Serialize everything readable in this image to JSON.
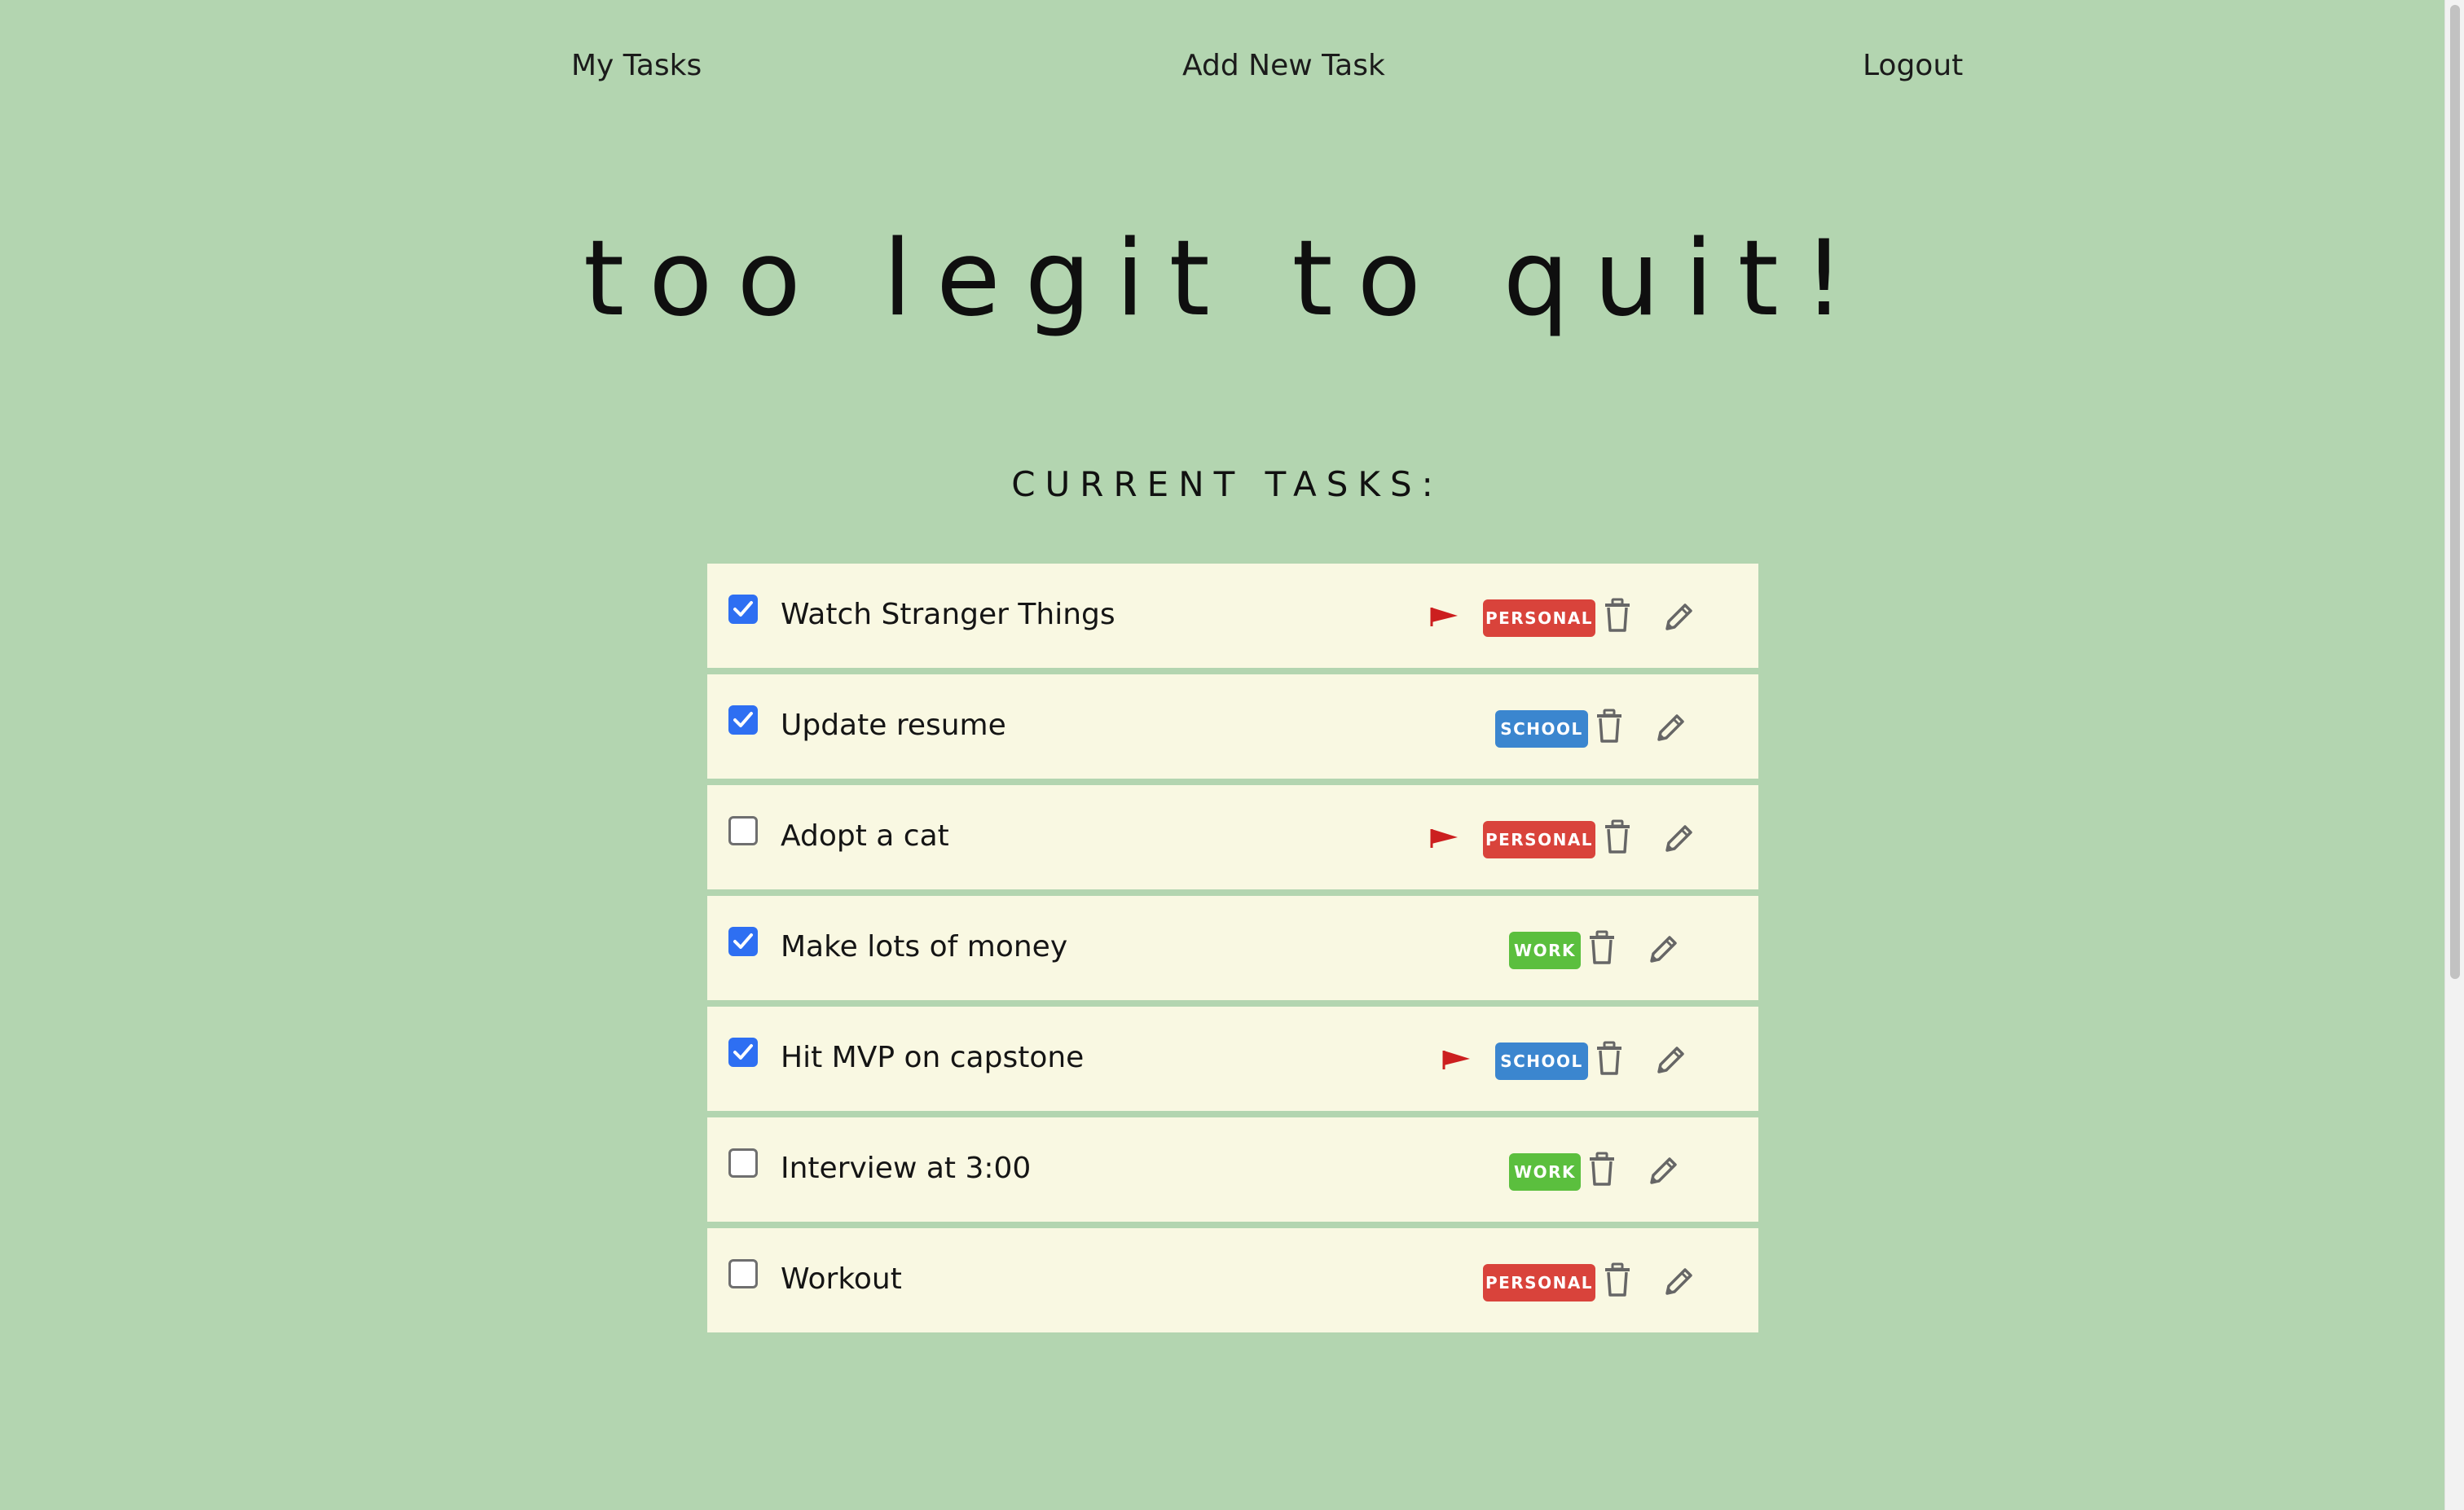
{
  "nav": {
    "my_tasks": "My Tasks",
    "add_task": "Add New Task",
    "logout": "Logout"
  },
  "hero": {
    "title": "too legit to quit!"
  },
  "section": {
    "title": "CURRENT TASKS:"
  },
  "colors": {
    "background": "#b3d5b0",
    "card": "#f9f8e2",
    "checkbox_checked": "#2e6ff2",
    "flag": "#cc1f1f",
    "personal": "#d9433b",
    "school": "#3b86cf",
    "work": "#5bbf3e",
    "icon": "#666666"
  },
  "tasks": [
    {
      "title": "Watch Stranger Things",
      "done": true,
      "flagged": true,
      "category": "PERSONAL",
      "category_key": "personal"
    },
    {
      "title": "Update resume",
      "done": true,
      "flagged": false,
      "category": "SCHOOL",
      "category_key": "school"
    },
    {
      "title": "Adopt a cat",
      "done": false,
      "flagged": true,
      "category": "PERSONAL",
      "category_key": "personal"
    },
    {
      "title": "Make lots of money",
      "done": true,
      "flagged": false,
      "category": "WORK",
      "category_key": "work"
    },
    {
      "title": "Hit MVP on capstone",
      "done": true,
      "flagged": true,
      "category": "SCHOOL",
      "category_key": "school"
    },
    {
      "title": "Interview at 3:00",
      "done": false,
      "flagged": false,
      "category": "WORK",
      "category_key": "work"
    },
    {
      "title": "Workout",
      "done": false,
      "flagged": false,
      "category": "PERSONAL",
      "category_key": "personal"
    }
  ],
  "icons": {
    "flag": "flag-icon",
    "delete": "trash-icon",
    "edit": "pencil-icon",
    "check": "checkmark-icon"
  }
}
